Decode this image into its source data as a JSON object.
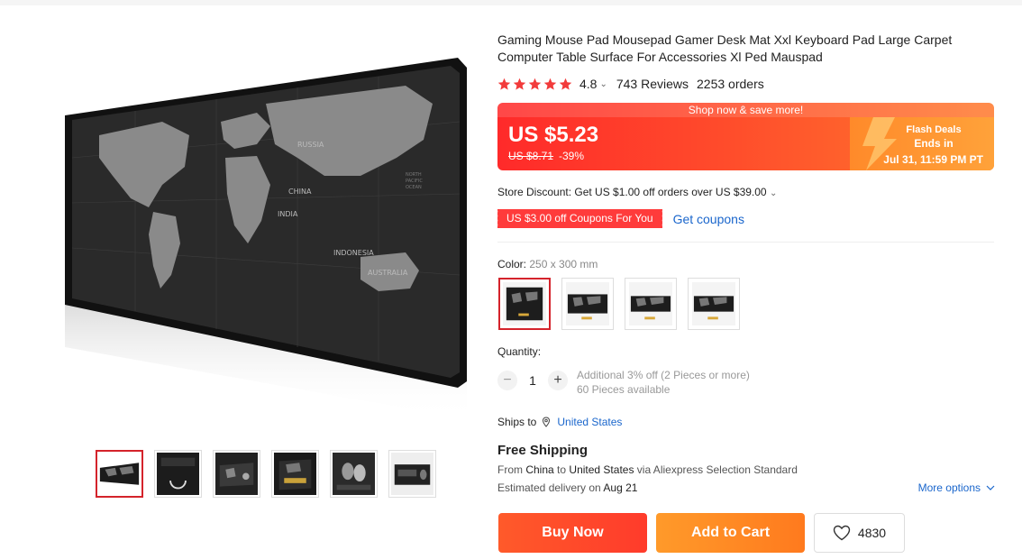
{
  "product": {
    "title": "Gaming Mouse Pad Mousepad Gamer Desk Mat Xxl Keyboard Pad Large Carpet Computer Table Surface For Accessories Xl Ped Mauspad",
    "rating": "4.8",
    "reviews": "743 Reviews",
    "orders": "2253 orders",
    "stars_filled": 5
  },
  "price": {
    "banner": "Shop now & save more!",
    "current": "US $5.23",
    "original": "US $8.71",
    "discount": "-39%",
    "flash_title": "Flash Deals",
    "flash_ends": "Ends in",
    "flash_date": "Jul 31, 11:59 PM PT"
  },
  "store_discount": "Store Discount: Get US $1.00 off orders over US $39.00",
  "coupon": {
    "label": "US $3.00 off Coupons For You",
    "link": "Get coupons"
  },
  "color": {
    "label": "Color:",
    "value": "250 x 300 mm"
  },
  "quantity": {
    "label": "Quantity:",
    "value": "1",
    "minus": "−",
    "plus": "+",
    "info1": "Additional 3% off (2 Pieces or more)",
    "info2": "60 Pieces available"
  },
  "shipping": {
    "ships_to_label": "Ships to",
    "country": "United States",
    "free": "Free Shipping",
    "from_prefix": "From",
    "from_country": "China",
    "to_word": "to",
    "to_country": "United States",
    "via": "via Aliexpress Selection Standard",
    "est_prefix": "Estimated delivery on",
    "est_date": "Aug 21",
    "more_options": "More options"
  },
  "actions": {
    "buy_now": "Buy Now",
    "add_to_cart": "Add to Cart",
    "wishlist_count": "4830"
  },
  "colors": {
    "accent_red": "#ff3b2b",
    "accent_orange": "#ff8a2a",
    "link_blue": "#1a66cc",
    "star": "#f5a623"
  }
}
